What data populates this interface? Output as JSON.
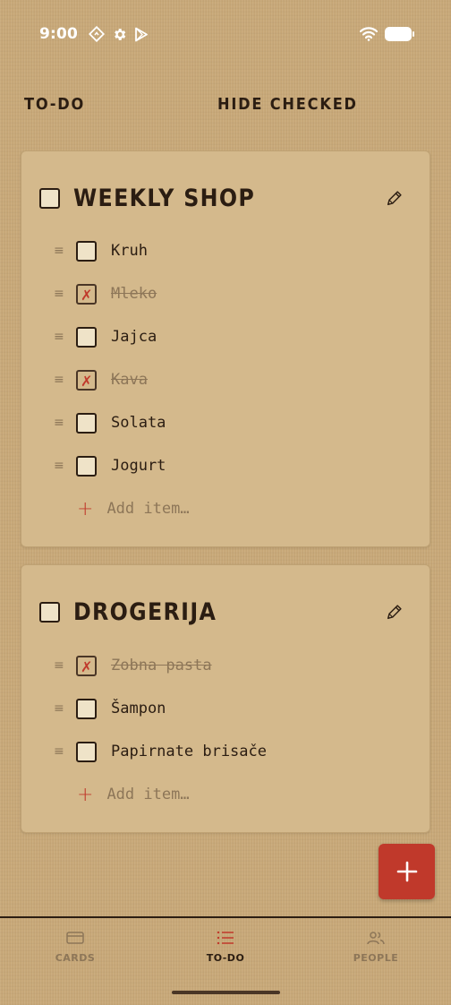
{
  "status_bar": {
    "time": "9:00",
    "left_icons": [
      "location-diamond-icon",
      "settings-gear-icon",
      "play-store-icon"
    ],
    "right_icons": [
      "wifi-icon",
      "battery-icon"
    ]
  },
  "header": {
    "title": "TO-DO",
    "hide_checked_label": "HIDE CHECKED"
  },
  "colors": {
    "background": "#c9a978",
    "card": "#d4b98c",
    "ink": "#2b1d12",
    "accent": "#c0392b",
    "muted": "#8d7658"
  },
  "lists": [
    {
      "title": "WEEKLY SHOP",
      "checked": false,
      "items": [
        {
          "label": "Kruh",
          "checked": false
        },
        {
          "label": "Mleko",
          "checked": true
        },
        {
          "label": "Jajca",
          "checked": false
        },
        {
          "label": "Kava",
          "checked": true
        },
        {
          "label": "Solata",
          "checked": false
        },
        {
          "label": "Jogurt",
          "checked": false
        }
      ],
      "add_item_placeholder": "Add item…"
    },
    {
      "title": "DROGERIJA",
      "checked": false,
      "items": [
        {
          "label": "Zobna pasta",
          "checked": true
        },
        {
          "label": "Šampon",
          "checked": false
        },
        {
          "label": "Papirnate brisače",
          "checked": false
        }
      ],
      "add_item_placeholder": "Add item…"
    }
  ],
  "fab": {
    "icon": "plus-icon"
  },
  "bottom_nav": {
    "items": [
      {
        "label": "CARDS",
        "icon": "card-icon",
        "active": false
      },
      {
        "label": "TO-DO",
        "icon": "list-icon",
        "active": true
      },
      {
        "label": "PEOPLE",
        "icon": "people-icon",
        "active": false
      }
    ]
  }
}
